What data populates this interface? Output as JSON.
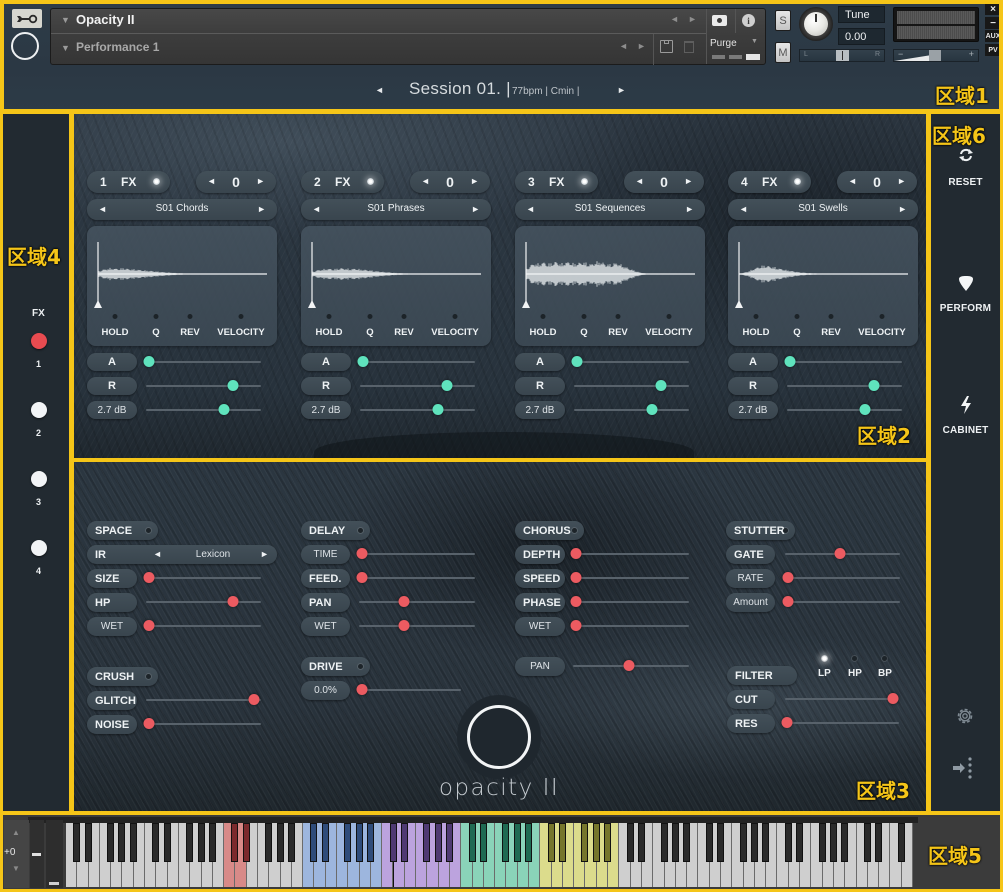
{
  "header": {
    "instrument_name": "Opacity II",
    "snapshot_name": "Performance 1",
    "purge_label": "Purge",
    "solo_label": "S",
    "mute_label": "M",
    "tune_label": "Tune",
    "tune_value": "0.00",
    "pan_left": "L",
    "pan_right": "R",
    "vol_minus": "−",
    "vol_plus": "+",
    "window_buttons": {
      "close": "×",
      "minimize": "−",
      "aux": "AUX",
      "pv": "PV"
    },
    "session_prev": "◄",
    "session_next": "►",
    "session_title": "Session 01. |",
    "session_info": "77bpm | Cmin |"
  },
  "fx_strip": {
    "title": "FX",
    "slots": [
      {
        "num": "1",
        "active": true,
        "color": "#e84b50"
      },
      {
        "num": "2",
        "active": false,
        "color": "#f2f4f6"
      },
      {
        "num": "3",
        "active": false,
        "color": "#f2f4f6"
      },
      {
        "num": "4",
        "active": false,
        "color": "#f2f4f6"
      }
    ]
  },
  "sample_panels": [
    {
      "index": "1",
      "fx_label": "FX",
      "transpose": "0",
      "preset": "S01 Chords",
      "toggles": [
        "HOLD",
        "Q",
        "REV",
        "VELOCITY"
      ],
      "attack_label": "A",
      "release_label": "R",
      "volume_label": "2.7 dB",
      "attack": 0.0,
      "release": 0.77,
      "volume": 0.69,
      "waveform": [
        0.12,
        0.22,
        0.26,
        0.3,
        0.28,
        0.27,
        0.3,
        0.26,
        0.24,
        0.23,
        0.2,
        0.18,
        0.16,
        0.14,
        0.12,
        0.1,
        0.08,
        0.07,
        0.05,
        0.04,
        0.03,
        0.02,
        0.01,
        0,
        0,
        0,
        0,
        0,
        0,
        0,
        0,
        0,
        0,
        0,
        0,
        0,
        0,
        0,
        0,
        0
      ]
    },
    {
      "index": "2",
      "fx_label": "FX",
      "transpose": "0",
      "preset": "S01 Phrases",
      "toggles": [
        "HOLD",
        "Q",
        "REV",
        "VELOCITY"
      ],
      "attack_label": "A",
      "release_label": "R",
      "volume_label": "2.7 dB",
      "attack": 0.0,
      "release": 0.77,
      "volume": 0.69,
      "waveform": [
        0.1,
        0.18,
        0.22,
        0.25,
        0.27,
        0.24,
        0.28,
        0.3,
        0.27,
        0.25,
        0.28,
        0.24,
        0.22,
        0.2,
        0.17,
        0.14,
        0.12,
        0.1,
        0.08,
        0.06,
        0.05,
        0.04,
        0.03,
        0.02,
        0.01,
        0,
        0,
        0,
        0,
        0,
        0,
        0,
        0,
        0,
        0,
        0,
        0,
        0,
        0,
        0
      ]
    },
    {
      "index": "3",
      "fx_label": "FX",
      "transpose": "0",
      "preset": "S01 Sequences",
      "toggles": [
        "HOLD",
        "Q",
        "REV",
        "VELOCITY"
      ],
      "attack_label": "A",
      "release_label": "R",
      "volume_label": "2.7 dB",
      "attack": 0.0,
      "release": 0.77,
      "volume": 0.69,
      "waveform": [
        0.2,
        0.45,
        0.55,
        0.5,
        0.62,
        0.5,
        0.56,
        0.64,
        0.5,
        0.6,
        0.62,
        0.52,
        0.56,
        0.62,
        0.55,
        0.5,
        0.6,
        0.64,
        0.55,
        0.48,
        0.52,
        0.58,
        0.46,
        0.36,
        0.26,
        0.18,
        0.1,
        0.05,
        0.02,
        0,
        0,
        0,
        0,
        0,
        0,
        0,
        0,
        0,
        0,
        0
      ]
    },
    {
      "index": "4",
      "fx_label": "FX",
      "transpose": "0",
      "preset": "S01 Swells",
      "toggles": [
        "HOLD",
        "Q",
        "REV",
        "VELOCITY"
      ],
      "attack_label": "A",
      "release_label": "R",
      "volume_label": "2.7 dB",
      "attack": 0.0,
      "release": 0.77,
      "volume": 0.69,
      "waveform": [
        0.02,
        0.06,
        0.12,
        0.22,
        0.32,
        0.4,
        0.44,
        0.4,
        0.35,
        0.3,
        0.25,
        0.2,
        0.16,
        0.12,
        0.09,
        0.07,
        0.05,
        0.04,
        0.03,
        0.02,
        0.01,
        0,
        0,
        0,
        0,
        0,
        0,
        0,
        0,
        0,
        0,
        0,
        0,
        0,
        0,
        0,
        0,
        0,
        0,
        0
      ]
    }
  ],
  "effects": {
    "space": {
      "title": "SPACE",
      "ir_label": "IR",
      "ir_value": "Lexicon",
      "size_label": "SIZE",
      "size": 0.0,
      "hp_label": "HP",
      "hp": 0.77,
      "wet_label": "WET",
      "wet": 0.0
    },
    "delay": {
      "title": "DELAY",
      "time_label": "TIME",
      "time": 0.0,
      "feedback_label": "FEED.",
      "feedback": 0.0,
      "pan_label": "PAN",
      "pan": 0.38,
      "wet_label": "WET",
      "wet": 0.38
    },
    "chorus": {
      "title": "CHORUS",
      "depth_label": "DEPTH",
      "depth": 0.0,
      "speed_label": "SPEED",
      "speed": 0.0,
      "phase_label": "PHASE",
      "phase": 0.0,
      "wet_label": "WET",
      "wet": 0.0
    },
    "stutter": {
      "title": "STUTTER",
      "gate_label": "GATE",
      "gate": 0.48,
      "rate_label": "RATE",
      "rate": 0.0,
      "amount_label": "Amount",
      "amount": 0.0
    },
    "crush": {
      "title": "CRUSH",
      "glitch_label": "GLITCH",
      "glitch": 0.96,
      "noise_label": "NOISE",
      "noise": 0.0
    },
    "drive": {
      "title": "DRIVE",
      "value_label": "0.0%",
      "amount": 0.0
    },
    "pan": {
      "label": "PAN",
      "value": 0.48
    },
    "filter": {
      "title": "FILTER",
      "modes": [
        "LP",
        "HP",
        "BP"
      ],
      "active_mode": "LP",
      "cut_label": "CUT",
      "cut": 1.0,
      "res_label": "RES",
      "res": 0.0
    }
  },
  "logo": {
    "text": "opacity II"
  },
  "sidebar": {
    "reset": "RESET",
    "perform": "PERFORM",
    "cabinet": "CABINET"
  },
  "keyboard": {
    "transpose": "+0",
    "first_note": 0,
    "last_note": 127,
    "zones": [
      {
        "from": 24,
        "to": 27,
        "white": "#d88a88",
        "black": "#7b2a2d"
      },
      {
        "from": 36,
        "to": 47,
        "white": "#9db6de",
        "black": "#2f4c7a"
      },
      {
        "from": 48,
        "to": 59,
        "white": "#bca3de",
        "black": "#4f3a72"
      },
      {
        "from": 60,
        "to": 71,
        "white": "#8ad3b9",
        "black": "#1f6a52"
      },
      {
        "from": 72,
        "to": 83,
        "white": "#dcdc8c",
        "black": "#76762c"
      }
    ]
  },
  "annotations": [
    "区域1",
    "区域2",
    "区域3",
    "区域4",
    "区域5",
    "区域6"
  ]
}
